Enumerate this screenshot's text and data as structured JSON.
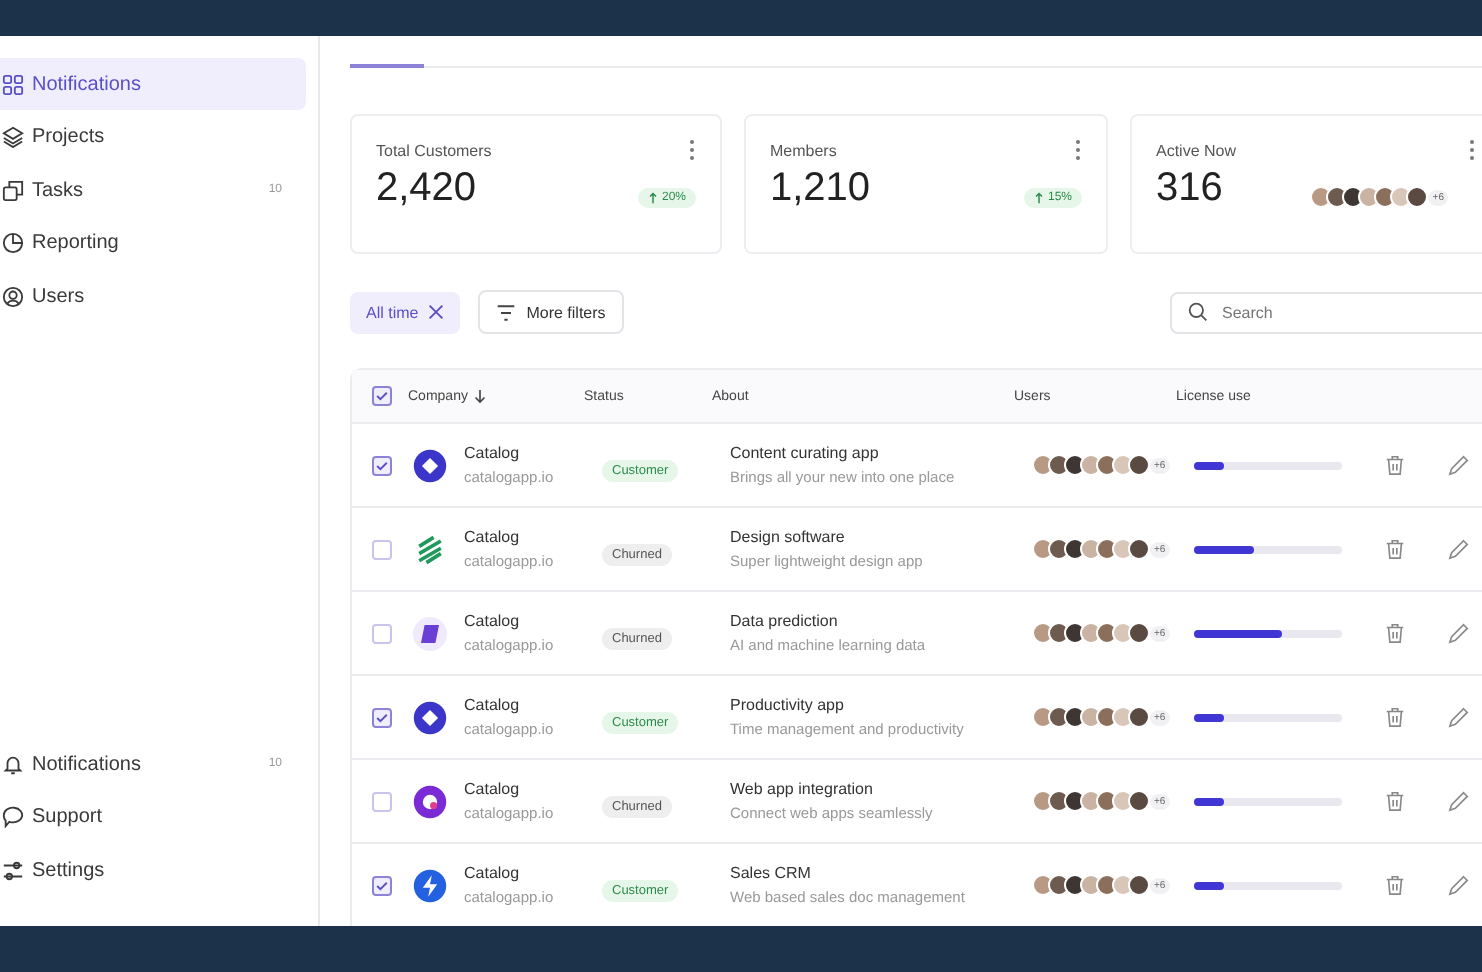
{
  "sidebar": {
    "items": [
      {
        "label": "Notifications",
        "selected": true
      },
      {
        "label": "Projects",
        "selected": false
      },
      {
        "label": "Tasks",
        "badge": "10",
        "selected": false
      },
      {
        "label": "Reporting",
        "selected": false
      },
      {
        "label": "Users",
        "selected": false
      }
    ],
    "footer_items": [
      {
        "label": "Notifications",
        "badge": "10"
      },
      {
        "label": "Support"
      },
      {
        "label": "Settings"
      }
    ]
  },
  "stats": [
    {
      "title": "Total Customers",
      "value": "2,420",
      "change": "20%"
    },
    {
      "title": "Members",
      "value": "1,210",
      "change": "15%"
    },
    {
      "title": "Active Now",
      "value": "316",
      "extra": "+6"
    }
  ],
  "filters": {
    "chip": "All time",
    "button": "More filters"
  },
  "search": {
    "placeholder": "Search"
  },
  "table": {
    "all_checked": true,
    "columns": [
      "Company",
      "Status",
      "About",
      "Users",
      "License use"
    ],
    "rows": [
      {
        "checked": true,
        "name": "Catalog",
        "domain": "catalogapp.io",
        "status": "Customer",
        "churned": false,
        "about": "Content curating app",
        "about_sub": "Brings all your new into one place",
        "users_extra": "+6",
        "level": 0.2
      },
      {
        "checked": false,
        "name": "Catalog",
        "domain": "catalogapp.io",
        "status": "Churned",
        "churned": true,
        "about": "Design software",
        "about_sub": "Super lightweight design app",
        "users_extra": "+6",
        "level": 0.4
      },
      {
        "checked": false,
        "name": "Catalog",
        "domain": "catalogapp.io",
        "status": "Churned",
        "churned": true,
        "about": "Data prediction",
        "about_sub": "AI and machine learning data",
        "users_extra": "+6",
        "level": 0.6
      },
      {
        "checked": true,
        "name": "Catalog",
        "domain": "catalogapp.io",
        "status": "Customer",
        "churned": false,
        "about": "Productivity app",
        "about_sub": "Time management and productivity",
        "users_extra": "+6",
        "level": 0.2
      },
      {
        "checked": false,
        "name": "Catalog",
        "domain": "catalogapp.io",
        "status": "Churned",
        "churned": true,
        "about": "Web app integration",
        "about_sub": "Connect web apps seamlessly",
        "users_extra": "+6",
        "level": 0.2
      },
      {
        "checked": true,
        "name": "Catalog",
        "domain": "catalogapp.io",
        "status": "Customer",
        "churned": false,
        "about": "Sales CRM",
        "about_sub": "Web based sales doc management",
        "users_extra": "+6",
        "level": 0.2
      }
    ]
  }
}
